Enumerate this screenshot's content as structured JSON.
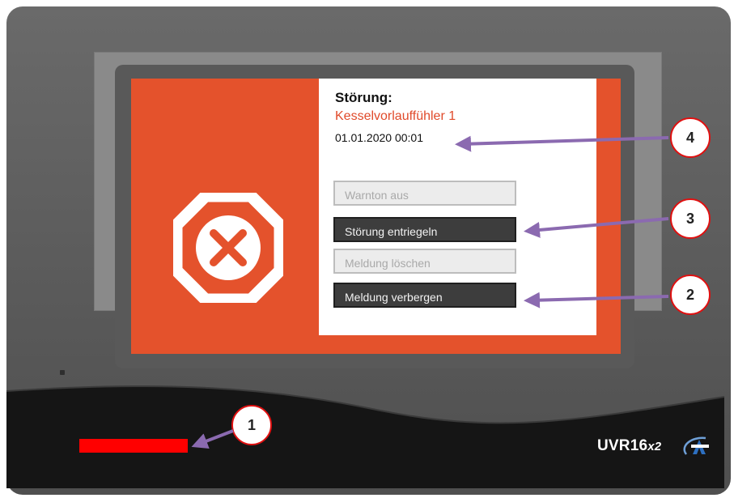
{
  "device": {
    "brand": "UVR16",
    "brand_suffix": "x2",
    "logo_icon": "ta-logo-icon",
    "status_led_color": "#ff0000"
  },
  "screen": {
    "background_color": "#e4522c",
    "icon": "stop-x-octagon-icon"
  },
  "dialog": {
    "title": "Störung:",
    "subtitle": "Kesselvorlauffühler 1",
    "subtitle_color": "#e04a2a",
    "timestamp": "01.01.2020 00:01",
    "buttons": [
      {
        "label": "Warnton aus",
        "enabled": false
      },
      {
        "label": "Störung entriegeln",
        "enabled": true
      },
      {
        "label": "Meldung löschen",
        "enabled": false
      },
      {
        "label": "Meldung verbergen",
        "enabled": true
      }
    ]
  },
  "callouts": [
    "1",
    "2",
    "3",
    "4"
  ],
  "annotation_colors": {
    "circle": "#e01010",
    "arrow": "#8b6ab0"
  }
}
